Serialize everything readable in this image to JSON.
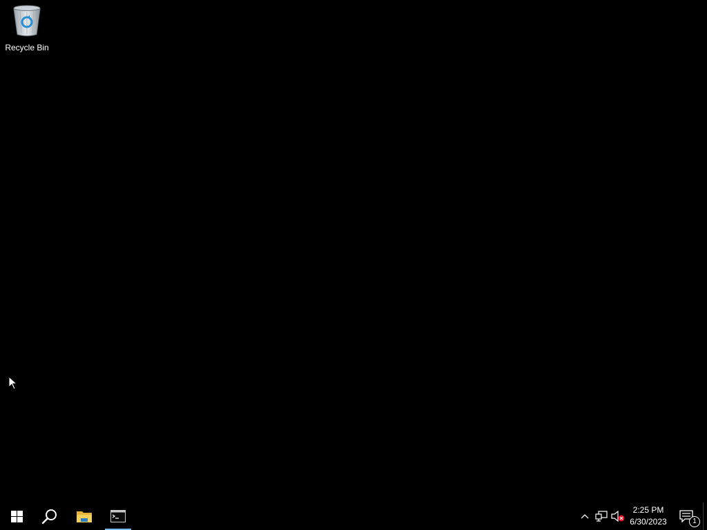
{
  "desktop": {
    "background_color": "#000000",
    "icons": [
      {
        "label": "Recycle Bin",
        "icon": "recycle-bin-icon"
      }
    ]
  },
  "taskbar": {
    "background_color": "#000000",
    "buttons": [
      {
        "icon": "windows-start-icon"
      },
      {
        "icon": "search-icon"
      },
      {
        "icon": "file-explorer-icon"
      },
      {
        "icon": "command-prompt-icon",
        "active": true
      }
    ],
    "tray": {
      "icons": [
        "chevron-up-icon",
        "network-icon",
        "volume-muted-icon"
      ],
      "time": "2:25 PM",
      "date": "6/30/2023",
      "notification_count": "1"
    },
    "accent_color": "#76b9ed"
  }
}
